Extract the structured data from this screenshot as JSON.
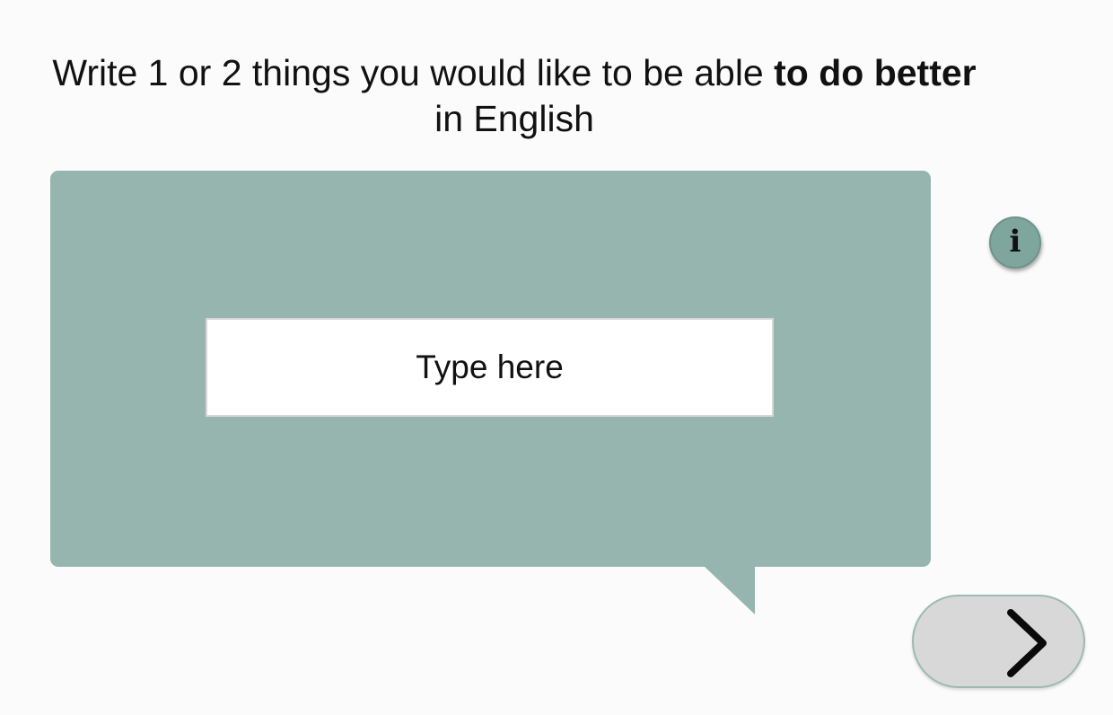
{
  "prompt": {
    "text_before": "Write 1 or 2 things you would like to be able ",
    "text_emphasis": "to do better",
    "text_after": "in English"
  },
  "answer": {
    "placeholder": "Type here",
    "value": ""
  },
  "info": {
    "icon": "info-icon",
    "glyph": "i"
  },
  "navigation": {
    "next_icon": "chevron-right-icon"
  },
  "colors": {
    "bubble": "#95b5ae",
    "info_button": "#7ea69d",
    "next_button": "#d8d8d8",
    "background": "#fbfbfb"
  }
}
